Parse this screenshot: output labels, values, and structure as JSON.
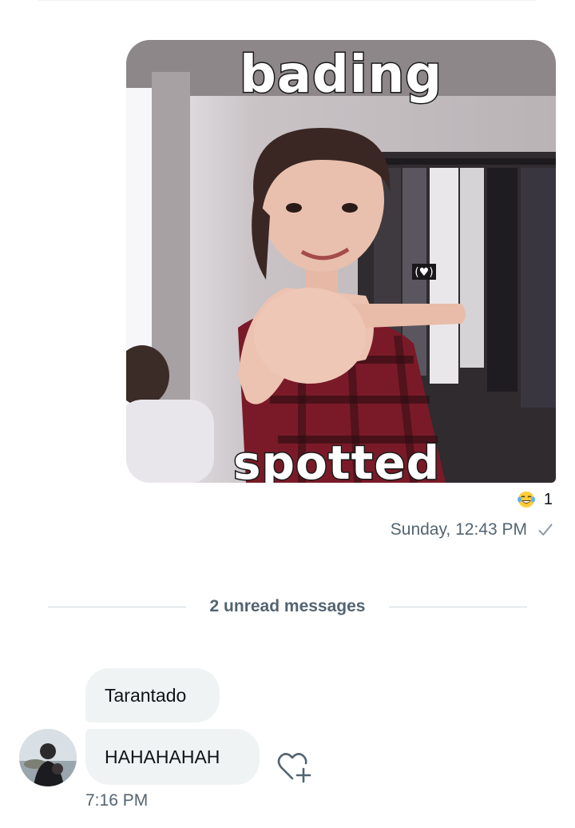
{
  "sent_message": {
    "image": {
      "caption_top": "bading",
      "caption_bottom": "spotted"
    },
    "reaction": {
      "emoji_icon": "face-with-tears-of-joy-icon",
      "count": "1"
    },
    "timestamp": "Sunday, 12:43 PM",
    "status_icon": "sent-check-icon"
  },
  "unread_divider": {
    "label": "2 unread messages"
  },
  "received_messages": {
    "messages": [
      {
        "text": "Tarantado"
      },
      {
        "text": "HAHAHAHAH"
      }
    ],
    "timestamp": "7:16 PM"
  },
  "colors": {
    "secondary_text": "#536471",
    "bubble_background": "#eff3f4",
    "divider": "#cfd9de"
  }
}
